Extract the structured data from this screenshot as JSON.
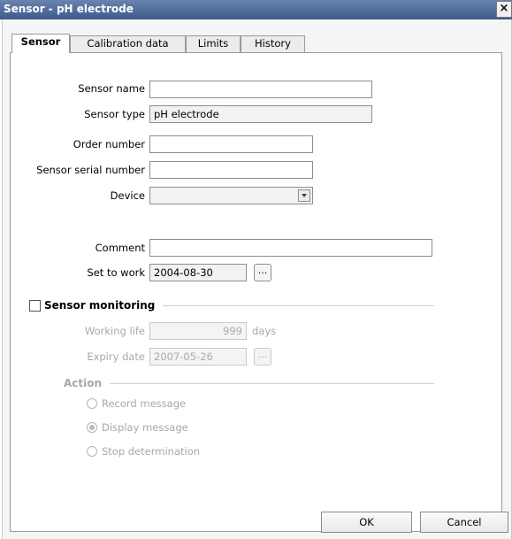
{
  "window": {
    "title": "Sensor - pH electrode",
    "close_glyph": "×"
  },
  "tabs": [
    "Sensor",
    "Calibration data",
    "Limits",
    "History"
  ],
  "active_tab": "Sensor",
  "form": {
    "sensor_name": {
      "label": "Sensor name",
      "value": ""
    },
    "sensor_type": {
      "label": "Sensor type",
      "value": "pH electrode"
    },
    "order_number": {
      "label": "Order number",
      "value": ""
    },
    "serial_number": {
      "label": "Sensor serial number",
      "value": ""
    },
    "device": {
      "label": "Device",
      "value": ""
    },
    "comment": {
      "label": "Comment",
      "value": ""
    },
    "set_to_work": {
      "label": "Set to work",
      "value": "2004-08-30",
      "button": "..."
    }
  },
  "monitoring": {
    "checkbox_label": "Sensor monitoring",
    "checked": false,
    "working_life": {
      "label": "Working life",
      "value": "999",
      "unit": "days"
    },
    "expiry_date": {
      "label": "Expiry date",
      "value": "2007-05-26",
      "button": "..."
    },
    "action": {
      "title": "Action",
      "options": [
        "Record message",
        "Display message",
        "Stop determination"
      ],
      "selected": "Display message"
    }
  },
  "buttons": {
    "ok": "OK",
    "cancel": "Cancel"
  }
}
